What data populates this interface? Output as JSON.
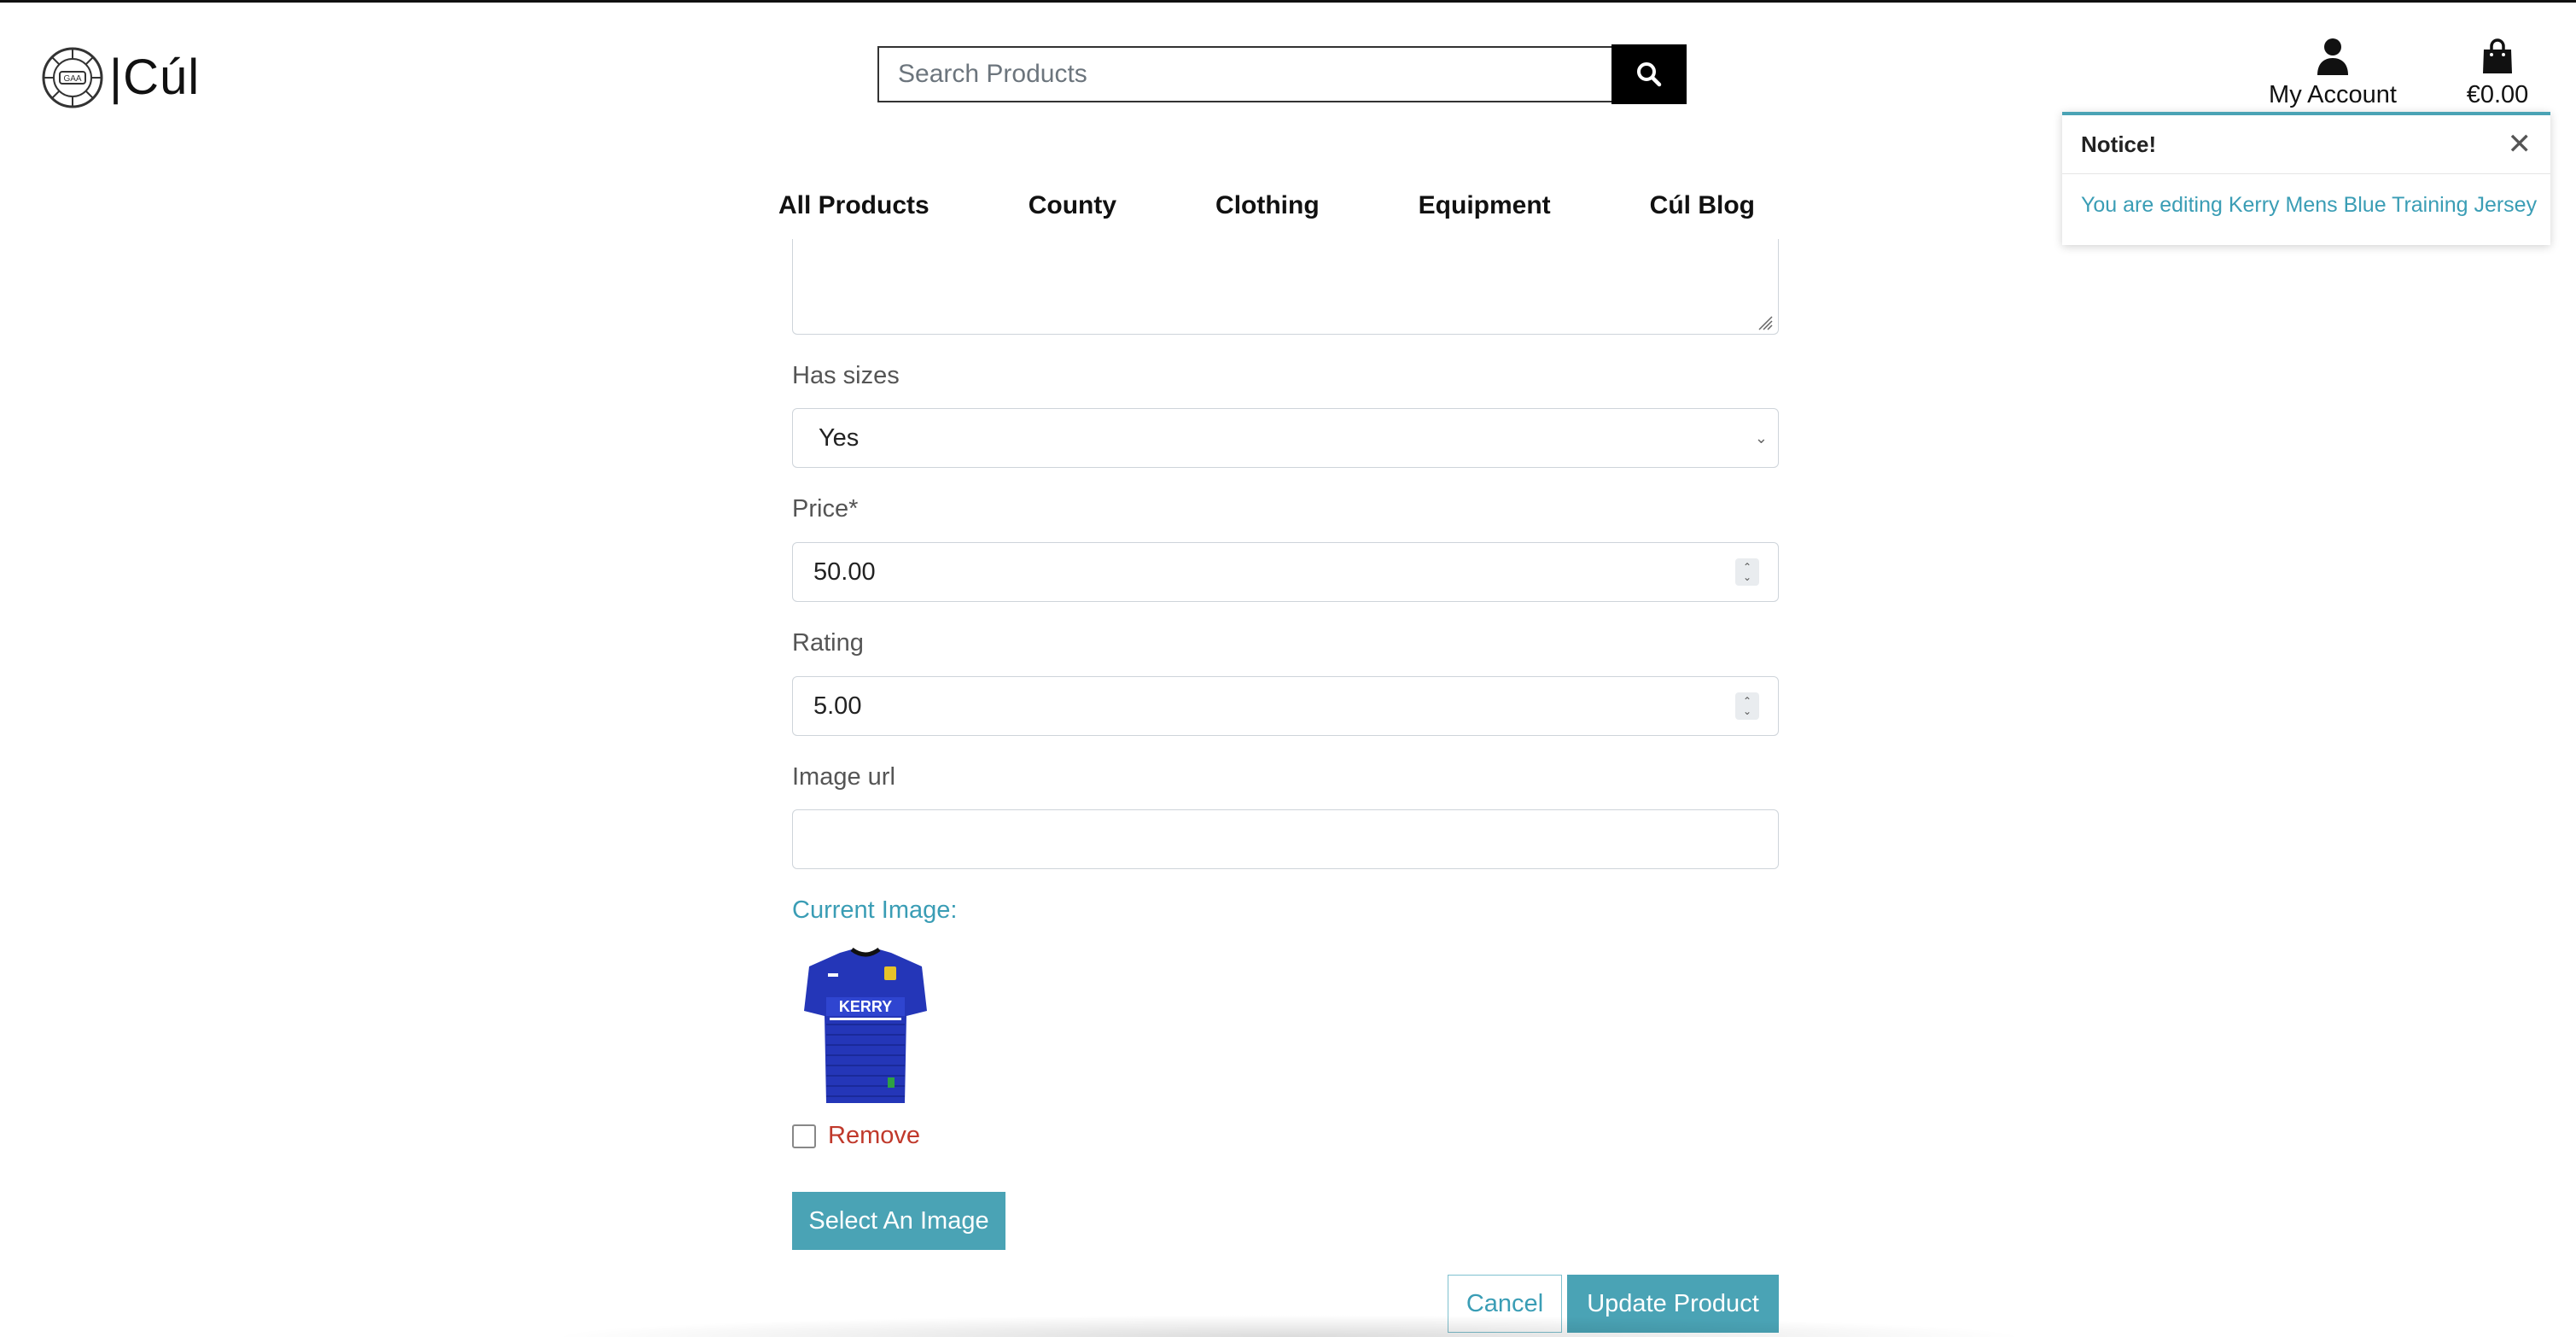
{
  "header": {
    "logo_text": "|Cúl",
    "logo_emblem_text": "GAA",
    "search": {
      "placeholder": "Search Products",
      "value": ""
    },
    "account_label": "My Account",
    "bag_total": "€0.00"
  },
  "nav": {
    "items": [
      {
        "label": "All Products"
      },
      {
        "label": "County"
      },
      {
        "label": "Clothing"
      },
      {
        "label": "Equipment"
      },
      {
        "label": "Cúl Blog"
      }
    ]
  },
  "toast": {
    "title": "Notice!",
    "close_glyph": "✕",
    "message": "You are editing Kerry Mens Blue Training Jersey",
    "accent_color": "#4aa3b5"
  },
  "form": {
    "has_sizes": {
      "label": "Has sizes",
      "value": "Yes"
    },
    "price": {
      "label": "Price*",
      "value": "50.00"
    },
    "rating": {
      "label": "Rating",
      "value": "5.00"
    },
    "image_url": {
      "label": "Image url",
      "value": ""
    },
    "current_image_label": "Current Image:",
    "jersey_text": "KERRY",
    "remove_label": "Remove",
    "remove_checked": false,
    "select_image_button": "Select An Image",
    "cancel_button": "Cancel",
    "update_button": "Update Product"
  },
  "colors": {
    "primary": "#4aa3b5",
    "danger": "#c0392b",
    "jersey_blue": "#2436b8"
  }
}
